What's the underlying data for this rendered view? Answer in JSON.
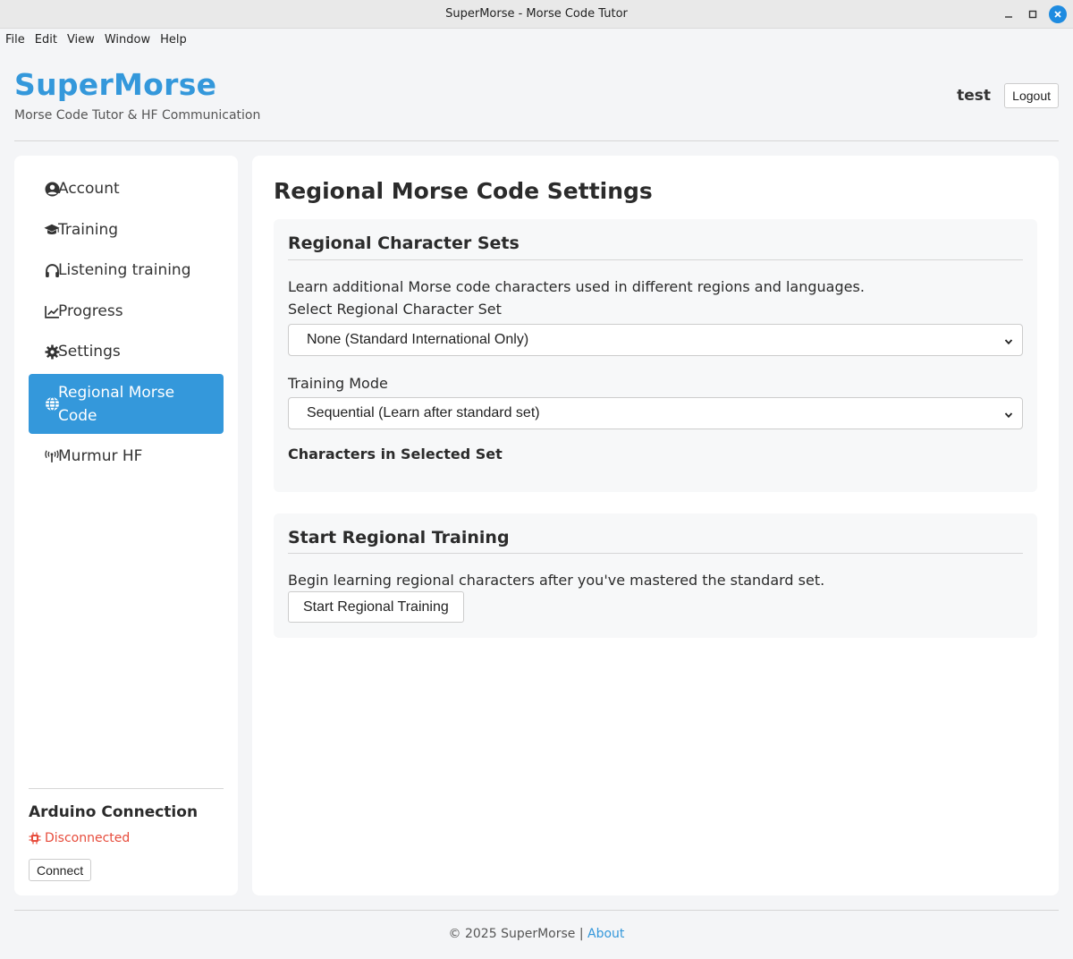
{
  "window": {
    "title": "SuperMorse - Morse Code Tutor",
    "controls": [
      "minimize",
      "maximize",
      "close"
    ]
  },
  "menubar": [
    "File",
    "Edit",
    "View",
    "Window",
    "Help"
  ],
  "header": {
    "brand": "SuperMorse",
    "tagline": "Morse Code Tutor & HF Communication",
    "username": "test",
    "logout_label": "Logout"
  },
  "sidebar": {
    "items": [
      {
        "label": "Account",
        "icon": "user-circle-icon"
      },
      {
        "label": "Training",
        "icon": "graduation-cap-icon"
      },
      {
        "label": "Listening training",
        "icon": "headphones-icon"
      },
      {
        "label": "Progress",
        "icon": "line-chart-icon"
      },
      {
        "label": "Settings",
        "icon": "gear-icon"
      },
      {
        "label": "Regional Morse Code",
        "icon": "globe-icon",
        "active": true
      },
      {
        "label": "Murmur HF",
        "icon": "antenna-icon"
      }
    ],
    "arduino": {
      "title": "Arduino Connection",
      "status": "Disconnected",
      "status_color": "#e74c3c",
      "connect_label": "Connect"
    }
  },
  "main": {
    "title": "Regional Morse Code Settings",
    "character_sets": {
      "heading": "Regional Character Sets",
      "description": "Learn additional Morse code characters used in different regions and languages.",
      "select_label": "Select Regional Character Set",
      "select_value": "None (Standard International Only)",
      "mode_label": "Training Mode",
      "mode_value": "Sequential (Learn after standard set)",
      "chars_heading": "Characters in Selected Set"
    },
    "start_training": {
      "heading": "Start Regional Training",
      "description": "Begin learning regional characters after you've mastered the standard set.",
      "button_label": "Start Regional Training"
    }
  },
  "footer": {
    "copyright": "© 2025 SuperMorse",
    "separator": "|",
    "about_label": "About"
  },
  "colors": {
    "accent": "#3498db",
    "danger": "#e74c3c"
  }
}
